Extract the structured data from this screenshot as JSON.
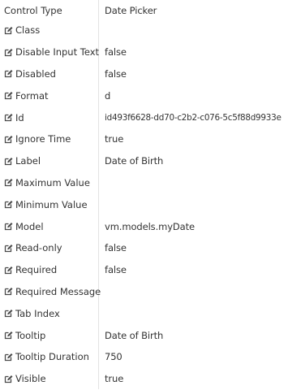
{
  "properties": [
    {
      "name": "Control Type",
      "value": "Date Picker",
      "editable": false
    },
    {
      "name": "Class",
      "value": "",
      "editable": true
    },
    {
      "name": "Disable Input Text",
      "value": "false",
      "editable": true
    },
    {
      "name": "Disabled",
      "value": "false",
      "editable": true
    },
    {
      "name": "Format",
      "value": "d",
      "editable": true
    },
    {
      "name": "Id",
      "value": "id493f6628-dd70-c2b2-c076-5c5f88d9933e",
      "editable": true
    },
    {
      "name": "Ignore Time",
      "value": "true",
      "editable": true
    },
    {
      "name": "Label",
      "value": "Date of Birth",
      "editable": true
    },
    {
      "name": "Maximum Value",
      "value": "",
      "editable": true
    },
    {
      "name": "Minimum Value",
      "value": "",
      "editable": true
    },
    {
      "name": "Model",
      "value": "vm.models.myDate",
      "editable": true
    },
    {
      "name": "Read-only",
      "value": "false",
      "editable": true
    },
    {
      "name": "Required",
      "value": "false",
      "editable": true
    },
    {
      "name": "Required Message",
      "value": "",
      "editable": true
    },
    {
      "name": "Tab Index",
      "value": "",
      "editable": true
    },
    {
      "name": "Tooltip",
      "value": "Date of Birth",
      "editable": true
    },
    {
      "name": "Tooltip Duration",
      "value": "750",
      "editable": true
    },
    {
      "name": "Visible",
      "value": "true",
      "editable": true
    }
  ],
  "icons": {
    "edit": "edit-icon"
  },
  "colors": {
    "text": "#333333",
    "divider": "#e3e3e3",
    "icon": "#4a4a4a"
  }
}
